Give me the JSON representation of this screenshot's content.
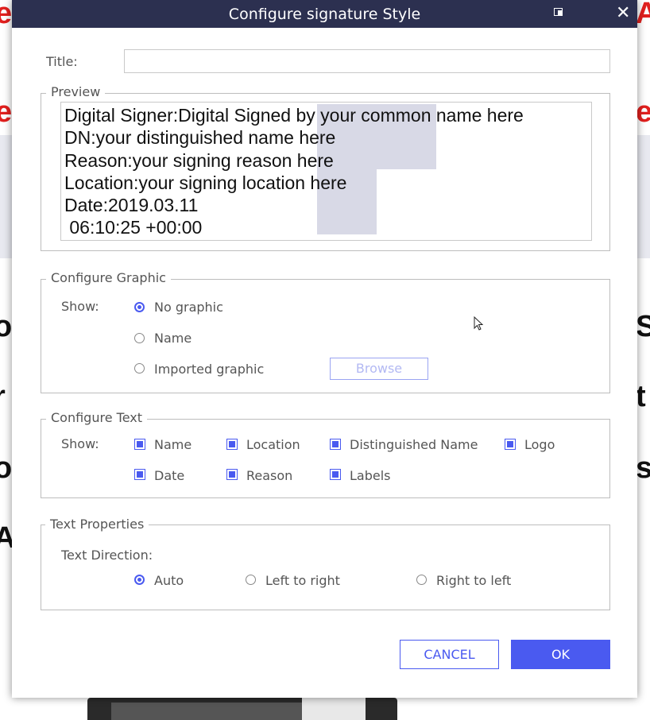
{
  "dialog": {
    "title": "Configure signature Style",
    "close_glyph": "✕",
    "title_label": "Title:",
    "title_value": ""
  },
  "preview": {
    "legend": "Preview",
    "text": "Digital Signer:Digital Signed by your common name here\nDN:your distinguished name here\nReason:your signing reason here\nLocation:your signing location here\nDate:2019.03.11\n 06:10:25 +00:00"
  },
  "graphic": {
    "legend": "Configure Graphic",
    "show_label": "Show:",
    "options": [
      "No graphic",
      "Name",
      "Imported graphic"
    ],
    "selected": "No graphic",
    "browse_label": "Browse"
  },
  "text_config": {
    "legend": "Configure Text",
    "show_label": "Show:",
    "options": [
      "Name",
      "Location",
      "Distinguished Name",
      "Logo",
      "Date",
      "Reason",
      "Labels"
    ],
    "checked": [
      true,
      true,
      true,
      true,
      true,
      true,
      true
    ]
  },
  "text_props": {
    "legend": "Text Properties",
    "direction_label": "Text Direction:",
    "options": [
      "Auto",
      "Left to right",
      "Right to left"
    ],
    "selected": "Auto"
  },
  "buttons": {
    "cancel": "CANCEL",
    "ok": "OK"
  },
  "colors": {
    "accent": "#4a5af0",
    "titlebar": "#2c3050"
  }
}
